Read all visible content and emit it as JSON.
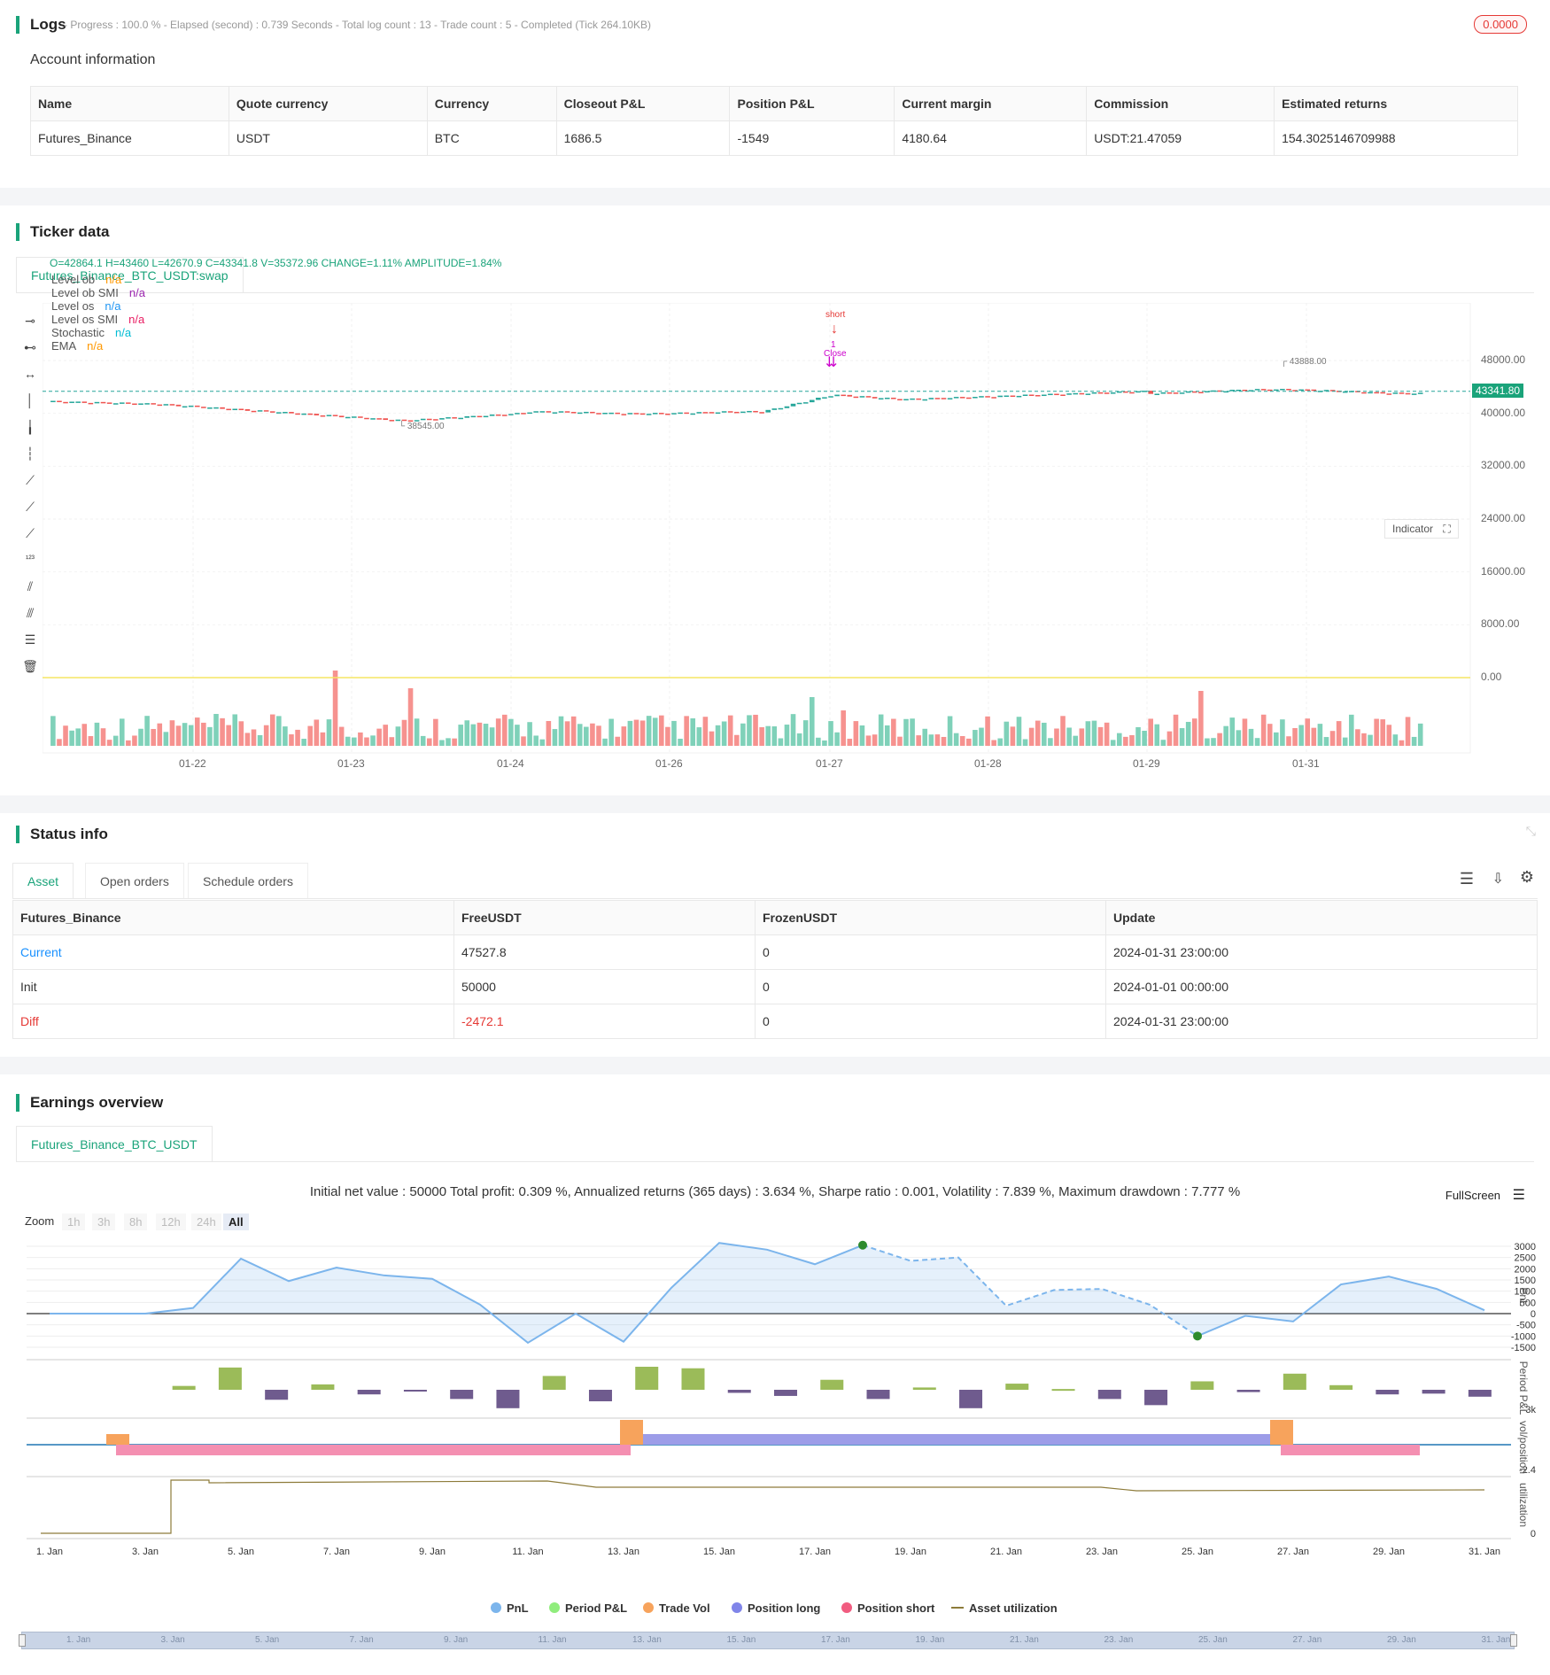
{
  "logs": {
    "title": "Logs",
    "status": "- Progress : 100.0 % - Elapsed (second) : 0.739  Seconds - Total log count : 13 - Trade count : 5 - Completed (Tick 264.10KB)",
    "badge": "0.0000"
  },
  "account": {
    "title": "Account information",
    "headers": [
      "Name",
      "Quote currency",
      "Currency",
      "Closeout P&L",
      "Position P&L",
      "Current margin",
      "Commission",
      "Estimated returns"
    ],
    "row": [
      "Futures_Binance",
      "USDT",
      "BTC",
      "1686.5",
      "-1549",
      "4180.64",
      "USDT:21.47059",
      "154.3025146709988"
    ]
  },
  "ticker": {
    "title": "Ticker data",
    "tab": "Futures_Binance_BTC_USDT:swap",
    "ohlc": "O=42864.1 H=43460 L=42670.9 C=43341.8 V=35372.96 CHANGE=1.11% AMPLITUDE=1.84%",
    "legend": [
      {
        "name": "Level ob",
        "value": "n/a",
        "color": "#ff9800"
      },
      {
        "name": "Level ob SMI",
        "value": "n/a",
        "color": "#9c27b0"
      },
      {
        "name": "Level os",
        "value": "n/a",
        "color": "#2196f3"
      },
      {
        "name": "Level os SMI",
        "value": "n/a",
        "color": "#e91e63"
      },
      {
        "name": "Stochastic",
        "value": "n/a",
        "color": "#00bcd4"
      },
      {
        "name": "EMA",
        "value": "n/a",
        "color": "#ff9800"
      }
    ],
    "indicator_btn": "Indicator",
    "price_label": "43341.80",
    "high_label": "43888.00",
    "low_label": "38545.00",
    "signal_short": "short",
    "signal_1": "1",
    "signal_close": "Close",
    "y_ticks": [
      "48000.00",
      "40000.00",
      "32000.00",
      "24000.00",
      "16000.00",
      "8000.00",
      "0.00"
    ],
    "x_ticks": [
      "01-22",
      "01-23",
      "01-24",
      "01-26",
      "01-27",
      "01-28",
      "01-29",
      "01-31"
    ]
  },
  "status": {
    "title": "Status info",
    "tabs": [
      "Asset",
      "Open orders",
      "Schedule orders"
    ],
    "headers": [
      "Futures_Binance",
      "FreeUSDT",
      "FrozenUSDT",
      "Update"
    ],
    "rows": [
      {
        "label": "Current",
        "free": "47527.8",
        "frozen": "0",
        "update": "2024-01-31 23:00:00"
      },
      {
        "label": "Init",
        "free": "50000",
        "frozen": "0",
        "update": "2024-01-01 00:00:00"
      },
      {
        "label": "Diff",
        "free": "-2472.1",
        "frozen": "0",
        "update": "2024-01-31 23:00:00"
      }
    ]
  },
  "earnings": {
    "title": "Earnings overview",
    "tab": "Futures_Binance_BTC_USDT",
    "summary": "Initial net value : 50000 Total profit: 0.309 %, Annualized returns (365 days) : 3.634 %, Sharpe ratio : 0.001, Volatility : 7.839 %, Maximum drawdown : 7.777 %",
    "fullscreen": "FullScreen",
    "zoom_label": "Zoom",
    "zoom_opts": [
      "1h",
      "3h",
      "8h",
      "12h",
      "24h",
      "All"
    ],
    "pnl_ticks": [
      "3000",
      "2500",
      "2000",
      "1500",
      "1000",
      "500",
      "0",
      "-500",
      "-1000",
      "-1500"
    ],
    "period_tick": "-3k",
    "vol_tick": "-2.4",
    "util_tick": "0",
    "axis_pnl": "PnL",
    "axis_period": "Period P&L",
    "axis_vol": "vol/position",
    "axis_util": "utilization",
    "x_ticks": [
      "1. Jan",
      "3. Jan",
      "5. Jan",
      "7. Jan",
      "9. Jan",
      "11. Jan",
      "13. Jan",
      "15. Jan",
      "17. Jan",
      "19. Jan",
      "21. Jan",
      "23. Jan",
      "25. Jan",
      "27. Jan",
      "29. Jan",
      "31. Jan"
    ],
    "legend": [
      {
        "name": "PnL",
        "color": "#7cb5ec"
      },
      {
        "name": "Period P&L",
        "color": "#90ed7d"
      },
      {
        "name": "Trade Vol",
        "color": "#f7a35c"
      },
      {
        "name": "Position long",
        "color": "#8085e9"
      },
      {
        "name": "Position short",
        "color": "#f15c80"
      },
      {
        "name": "Asset utilization",
        "color": "#8d7b3a"
      }
    ],
    "chart_data": {
      "type": "line",
      "x": [
        "1. Jan",
        "2. Jan",
        "3. Jan",
        "4. Jan",
        "5. Jan",
        "6. Jan",
        "7. Jan",
        "8. Jan",
        "9. Jan",
        "10. Jan",
        "11. Jan",
        "12. Jan",
        "13. Jan",
        "14. Jan",
        "15. Jan",
        "16. Jan",
        "17. Jan",
        "18. Jan",
        "19. Jan",
        "20. Jan",
        "21. Jan",
        "22. Jan",
        "23. Jan",
        "24. Jan",
        "25. Jan",
        "26. Jan",
        "27. Jan",
        "28. Jan",
        "29. Jan",
        "30. Jan",
        "31. Jan"
      ],
      "series": [
        {
          "name": "PnL",
          "values": [
            0,
            0,
            0,
            250,
            2450,
            1450,
            2050,
            1700,
            1550,
            400,
            -1300,
            0,
            -1250,
            1150,
            3150,
            2850,
            2200,
            3050,
            2350,
            2500,
            350,
            1050,
            1100,
            400,
            -1000,
            -100,
            -350,
            1300,
            1650,
            1100,
            150
          ]
        },
        {
          "name": "Period P&L",
          "values": [
            0,
            0,
            0,
            250,
            1450,
            -650,
            350,
            -300,
            -80,
            -600,
            -1200,
            900,
            -750,
            1500,
            1400,
            -200,
            -400,
            650,
            -600,
            150,
            -1200,
            400,
            50,
            -600,
            -1000,
            550,
            -150,
            1050,
            300,
            -300,
            -250,
            -450
          ]
        }
      ],
      "ylim": [
        -1500,
        3000
      ]
    }
  }
}
